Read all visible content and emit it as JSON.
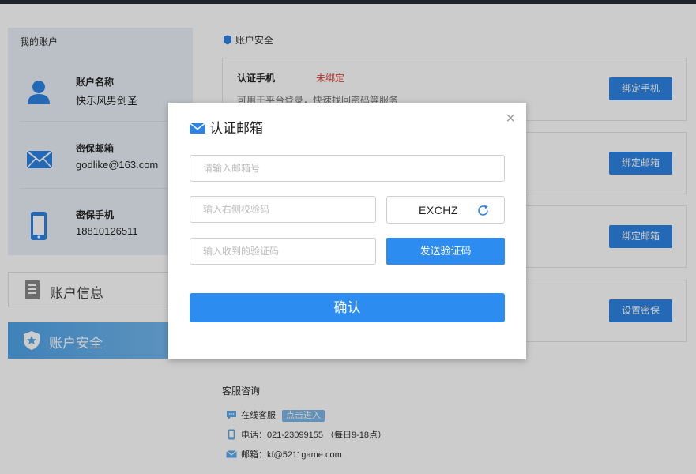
{
  "account": {
    "section_title": "我的账户",
    "items": [
      {
        "label": "账户名称",
        "value": "快乐风男剑圣",
        "icon": "user-icon"
      },
      {
        "label": "密保邮箱",
        "value": "godlike@163.com",
        "icon": "mail-icon"
      },
      {
        "label": "密保手机",
        "value": "18810126511",
        "icon": "phone-icon"
      }
    ]
  },
  "nav": {
    "info_label": "账户信息",
    "security_label": "账户安全"
  },
  "security": {
    "title": "账户安全",
    "boxes": [
      {
        "name": "认证手机",
        "status": "未绑定",
        "desc": "可用于平台登录，快速找回密码等服务",
        "button": "绑定手机"
      },
      {
        "button": "绑定邮箱"
      },
      {
        "button": "绑定邮箱"
      },
      {
        "button": "设置密保"
      }
    ]
  },
  "support": {
    "title": "客服咨询",
    "online_label": "在线客服",
    "online_tag": "点击进入",
    "phone": "电话：021-23099155 （每日9-18点）",
    "email": "邮箱：kf@5211game.com"
  },
  "modal": {
    "title": "认证邮箱",
    "email_placeholder": "请输入邮箱号",
    "captcha_placeholder": "输入右侧校验码",
    "captcha_code": "EXCHZ",
    "code_placeholder": "输入收到的验证码",
    "send_button": "发送验证码",
    "confirm_button": "确认",
    "close": "×"
  },
  "colors": {
    "primary": "#2d8cf0",
    "warning": "#e0423a",
    "overlay": "rgba(0,0,0,0.20)"
  }
}
